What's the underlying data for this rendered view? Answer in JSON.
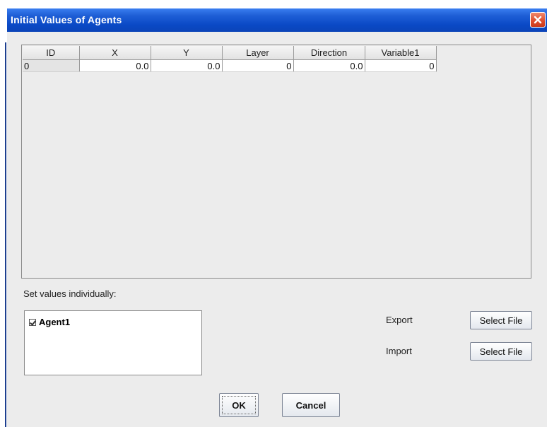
{
  "dialog": {
    "title": "Initial Values of Agents",
    "close_icon": "close-icon"
  },
  "table": {
    "columns": [
      "ID",
      "X",
      "Y",
      "Layer",
      "Direction",
      "Variable1"
    ],
    "rows": [
      [
        "0",
        "0.0",
        "0.0",
        "0",
        "0.0",
        "0"
      ]
    ]
  },
  "individual": {
    "label": "Set values individually:",
    "agents": [
      {
        "name": "Agent1",
        "checked": true
      }
    ]
  },
  "export": {
    "label": "Export",
    "button": "Select File"
  },
  "import": {
    "label": "Import",
    "button": "Select File"
  },
  "buttons": {
    "ok": "OK",
    "cancel": "Cancel"
  },
  "colors": {
    "titlebar": "#0a49c6",
    "close": "#dd4a2a",
    "dialog_bg": "#ececec"
  }
}
